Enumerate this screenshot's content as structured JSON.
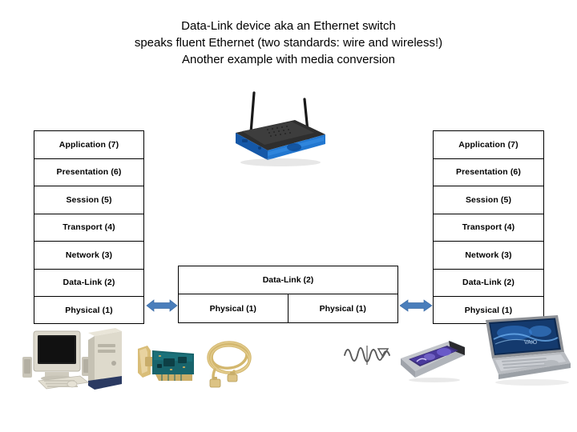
{
  "title": {
    "line1": "Data-Link device aka an Ethernet switch",
    "line2": "speaks fluent Ethernet (two standards: wire and wireless!)",
    "line3": "Another example with media conversion"
  },
  "colors": {
    "arrow": "#4a7ebb",
    "arrow_dark": "#3c6ca6",
    "border": "#000000",
    "background": "#ffffff",
    "router_body": "#1d64b5",
    "router_top": "#2b2b2b",
    "desktop_case": "#d8d4c8",
    "nic_board": "#1d6f77",
    "cable": "#d8bc72",
    "wave": "#5a5a5a",
    "pcmcia_label": "#4a3a86",
    "laptop_screen": "#12325f"
  },
  "left_stack": {
    "name": "OSI stack left host",
    "layers": [
      {
        "label": "Application (7)"
      },
      {
        "label": "Presentation (6)"
      },
      {
        "label": "Session (5)"
      },
      {
        "label": "Transport (4)"
      },
      {
        "label": "Network (3)"
      },
      {
        "label": "Data-Link (2)"
      },
      {
        "label": "Physical (1)"
      }
    ]
  },
  "right_stack": {
    "name": "OSI stack right host",
    "layers": [
      {
        "label": "Application (7)"
      },
      {
        "label": "Presentation (6)"
      },
      {
        "label": "Session (5)"
      },
      {
        "label": "Transport (4)"
      },
      {
        "label": "Network (3)"
      },
      {
        "label": "Data-Link (2)"
      },
      {
        "label": "Physical (1)"
      }
    ]
  },
  "middle_stack": {
    "name": "Ethernet switch layers",
    "datalink_label": "Data-Link (2)",
    "physical_left_label": "Physical (1)",
    "physical_right_label": "Physical (1)"
  },
  "arrows": {
    "left": {
      "name": "wired link arrow",
      "direction": "bidirectional"
    },
    "right": {
      "name": "wireless link arrow",
      "direction": "bidirectional"
    }
  },
  "artwork": {
    "router": "wireless-router-photo",
    "desktop": "desktop-computer-photo",
    "nic": "pci-network-card-photo",
    "cable": "ethernet-cable-photo",
    "waves": "radio-waves-symbol",
    "pcmcia": "pcmcia-wireless-card-photo",
    "laptop": "laptop-computer-photo"
  }
}
